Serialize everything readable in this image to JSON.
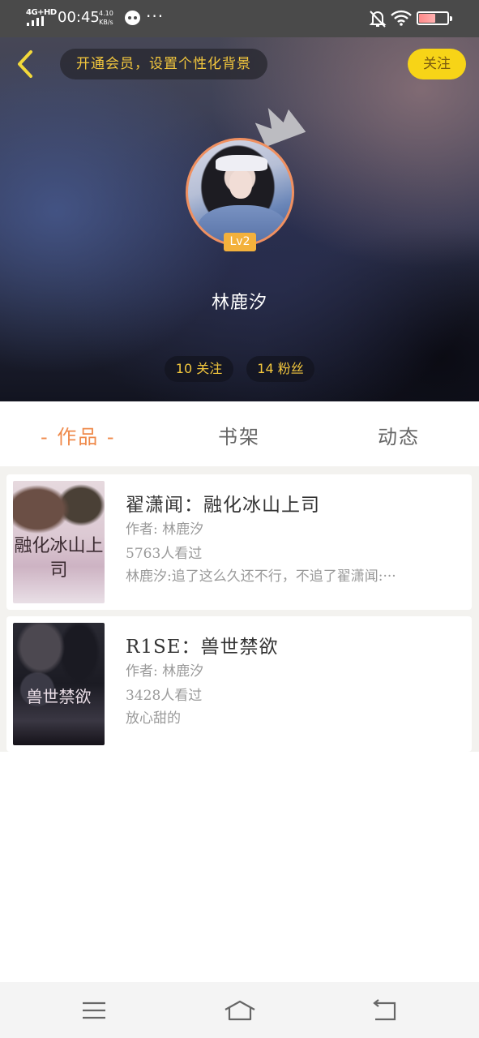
{
  "status_bar": {
    "network": "4G+HD",
    "time": "00:45",
    "speed_value": "4.10",
    "speed_unit": "KB/s",
    "more": "···",
    "battery_level": 0.55
  },
  "header": {
    "vip_prompt": "开通会员，设置个性化背景",
    "follow_label": "关注",
    "level_badge": "Lv2",
    "username": "林鹿汐",
    "following_stat": "10 关注",
    "fans_stat": "14 粉丝"
  },
  "tabs": [
    {
      "label": "- 作品 -",
      "active": true
    },
    {
      "label": "书架",
      "active": false
    },
    {
      "label": "动态",
      "active": false
    }
  ],
  "books": [
    {
      "title": "翟潇闻：融化冰山上司",
      "author": "作者: 林鹿汐",
      "views": "5763人看过",
      "description": "林鹿汐:追了这么久还不行，不追了翟潇闻:···",
      "cover_text": "融化冰山上司"
    },
    {
      "title": "R1SE：兽世禁欲",
      "author": "作者: 林鹿汐",
      "views": "3428人看过",
      "description": "放心甜的",
      "cover_text": "兽世禁欲"
    }
  ],
  "colors": {
    "accent": "#ef8a4b",
    "gold_text": "#f3c73d",
    "follow_bg": "#f7d417",
    "badge_bg": "#f3b13c"
  }
}
